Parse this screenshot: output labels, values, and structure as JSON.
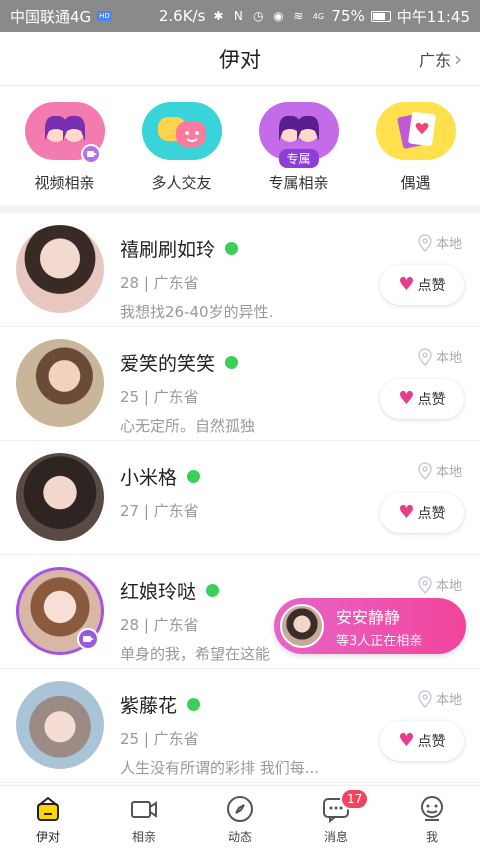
{
  "status_bar": {
    "carrier": "中国联通4G",
    "carrier_badge": "HD",
    "speed": "2.6K/s",
    "signal": "4G",
    "battery": "75%",
    "time": "中午11:45"
  },
  "header": {
    "title": "伊对",
    "region": "广东",
    "region_chevron": "›"
  },
  "categories": [
    {
      "label": "视频相亲",
      "icon": "couple-video-icon",
      "color": "#f47bb0"
    },
    {
      "label": "多人交友",
      "icon": "group-chat-icon",
      "color": "#3ad3d9"
    },
    {
      "label": "专属相亲",
      "icon": "couple-exclusive-icon",
      "color": "#c36be8",
      "tag": "专属"
    },
    {
      "label": "偶遇",
      "icon": "card-heart-icon",
      "color": "#ffe14d"
    }
  ],
  "users": [
    {
      "name": "禧刷刷如玲",
      "age_region": "28 | 广东省",
      "desc": "我想找26-40岁的异性.",
      "location": "本地",
      "like": "点赞",
      "avatar_color": "#e9c7c1"
    },
    {
      "name": "爱笑的笑笑",
      "age_region": "25 | 广东省",
      "desc": "心无定所。自然孤独",
      "location": "本地",
      "like": "点赞",
      "avatar_color": "#c9b59a"
    },
    {
      "name": "小米格",
      "age_region": "27 | 广东省",
      "desc": "",
      "location": "本地",
      "like": "点赞",
      "avatar_color": "#5a4a44"
    },
    {
      "name": "红娘玲哒",
      "age_region": "28 | 广东省",
      "desc": "单身的我，希望在这能",
      "location": "本地",
      "like": "",
      "avatar_color": "#d8b7a6"
    },
    {
      "name": "紫藤花",
      "age_region": "25 | 广东省",
      "desc": "人生没有所谓的彩排 我们每...",
      "location": "本地",
      "like": "点赞",
      "avatar_color": "#a9c4d6"
    }
  ],
  "live_popup": {
    "name": "安安静静",
    "sub": "等3人正在相亲"
  },
  "tabs": [
    {
      "label": "伊对",
      "icon": "home-icon",
      "active": true
    },
    {
      "label": "相亲",
      "icon": "video-camera-icon"
    },
    {
      "label": "动态",
      "icon": "compass-icon"
    },
    {
      "label": "消息",
      "icon": "message-icon",
      "badge": "17"
    },
    {
      "label": "我",
      "icon": "profile-icon"
    }
  ],
  "colors": {
    "online": "#3ccf57",
    "heart": "#e83c8c",
    "accent_purple": "#a554e0",
    "badge_red": "#f2445f"
  }
}
